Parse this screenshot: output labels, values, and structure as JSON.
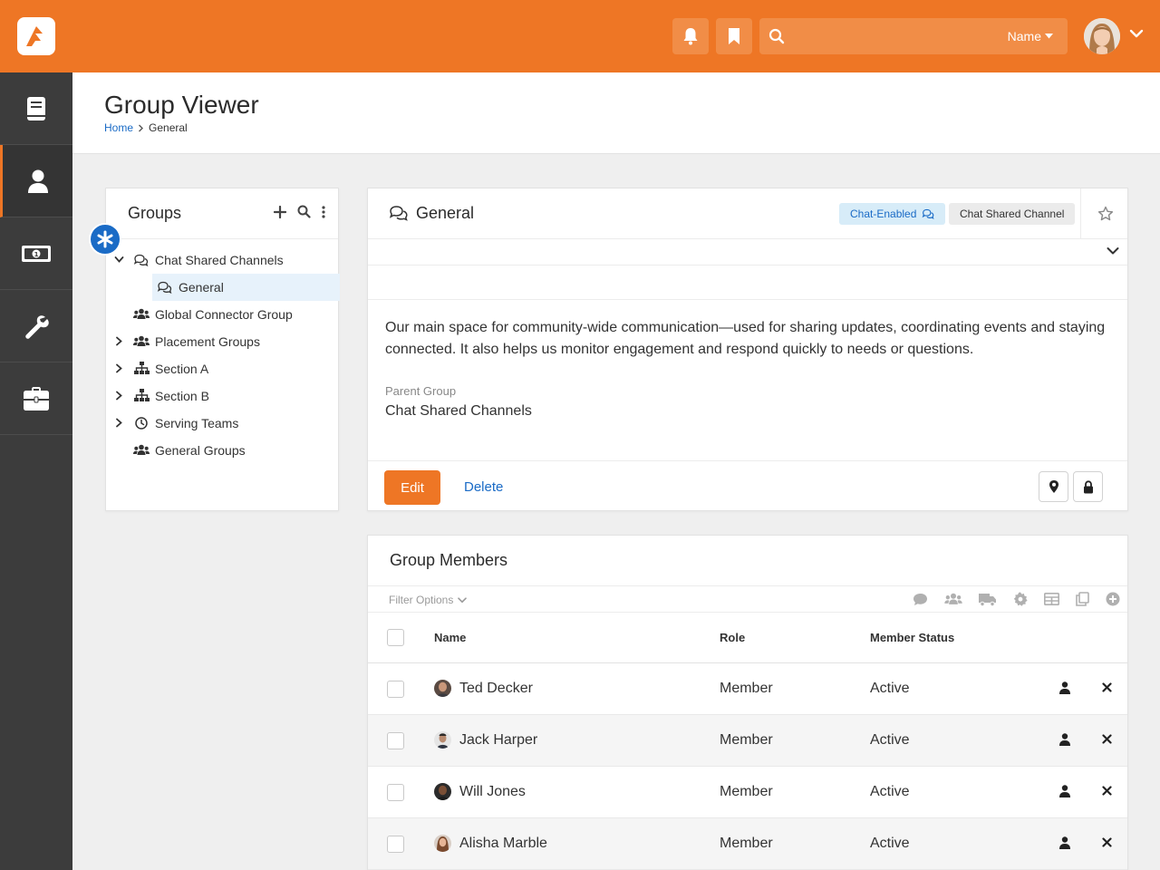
{
  "header": {
    "search_select_label": "Name"
  },
  "page": {
    "title": "Group Viewer",
    "breadcrumb": [
      {
        "label": "Home"
      },
      {
        "label": "General"
      }
    ]
  },
  "groups_panel": {
    "title": "Groups",
    "items": [
      {
        "label": "Chat Shared Channels",
        "icon": "chat-icon",
        "expanded": true
      },
      {
        "label": "General",
        "icon": "chat-icon",
        "selected": true
      },
      {
        "label": "Global Connector Group",
        "icon": "users-icon"
      },
      {
        "label": "Placement Groups",
        "icon": "users-icon",
        "expandable": true
      },
      {
        "label": "Section A",
        "icon": "sitemap-icon",
        "expandable": true
      },
      {
        "label": "Section B",
        "icon": "sitemap-icon",
        "expandable": true
      },
      {
        "label": "Serving Teams",
        "icon": "clock-icon",
        "expandable": true
      },
      {
        "label": "General Groups",
        "icon": "users-icon"
      }
    ]
  },
  "group_detail": {
    "title": "General",
    "labels": {
      "chat_enabled": "Chat-Enabled",
      "shared_channel": "Chat Shared Channel"
    },
    "description": "Our main space for community-wide communication—used for sharing updates, coordinating events and staying connected. It also helps us monitor engagement and respond quickly to needs or questions.",
    "parent_group_label": "Parent Group",
    "parent_group_value": "Chat Shared Channels",
    "edit_label": "Edit",
    "delete_label": "Delete"
  },
  "members": {
    "title": "Group Members",
    "filter_label": "Filter Options",
    "columns": {
      "name": "Name",
      "role": "Role",
      "status": "Member Status"
    },
    "rows": [
      {
        "name": "Ted Decker",
        "role": "Member",
        "status": "Active"
      },
      {
        "name": "Jack Harper",
        "role": "Member",
        "status": "Active"
      },
      {
        "name": "Will Jones",
        "role": "Member",
        "status": "Active"
      },
      {
        "name": "Alisha Marble",
        "role": "Member",
        "status": "Active"
      }
    ]
  },
  "colors": {
    "brand": "#ee7625",
    "link": "#1a6bc6",
    "sidebar": "#3c3c3c"
  }
}
